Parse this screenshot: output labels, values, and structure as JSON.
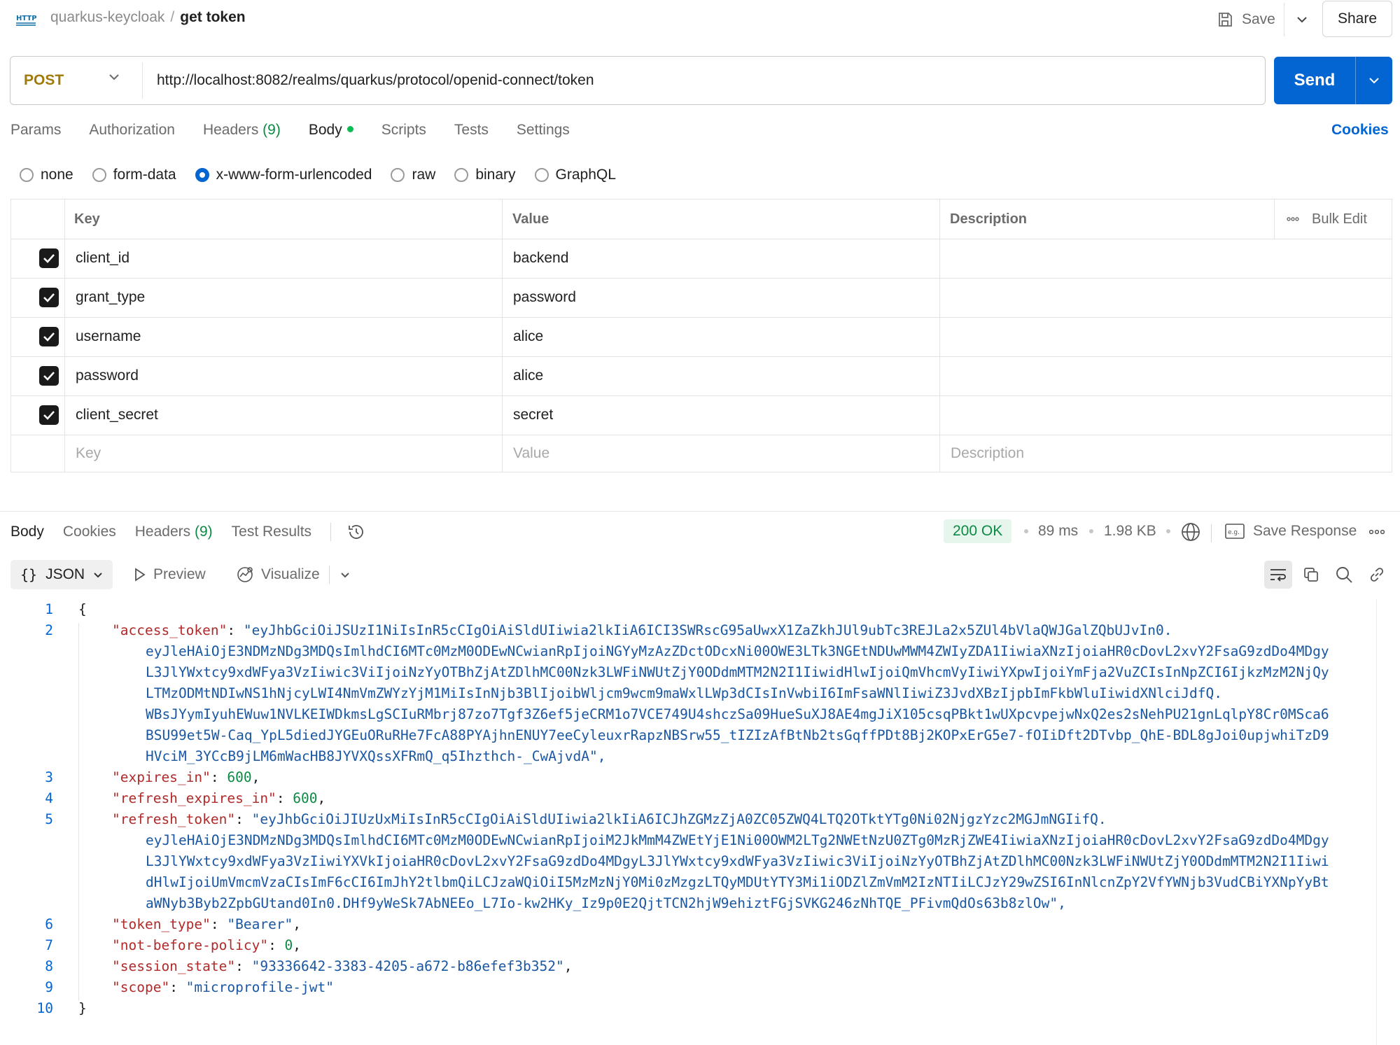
{
  "header": {
    "collection": "quarkus-keycloak",
    "separator": "/",
    "request_name": "get token",
    "save_label": "Save",
    "share_label": "Share"
  },
  "request": {
    "method": "POST",
    "url": "http://localhost:8082/realms/quarkus/protocol/openid-connect/token",
    "send_label": "Send"
  },
  "request_tabs": [
    {
      "label": "Params"
    },
    {
      "label": "Authorization"
    },
    {
      "label": "Headers",
      "count": "(9)"
    },
    {
      "label": "Body"
    },
    {
      "label": "Scripts"
    },
    {
      "label": "Tests"
    },
    {
      "label": "Settings"
    }
  ],
  "cookies_label": "Cookies",
  "body_types": [
    "none",
    "form-data",
    "x-www-form-urlencoded",
    "raw",
    "binary",
    "GraphQL"
  ],
  "body_type_selected": "x-www-form-urlencoded",
  "params_table": {
    "headers": {
      "key": "Key",
      "value": "Value",
      "description": "Description",
      "bulk_edit": "Bulk Edit"
    },
    "rows": [
      {
        "key": "client_id",
        "value": "backend",
        "checked": true
      },
      {
        "key": "grant_type",
        "value": "password",
        "checked": true
      },
      {
        "key": "username",
        "value": "alice",
        "checked": true
      },
      {
        "key": "password",
        "value": "alice",
        "checked": true
      },
      {
        "key": "client_secret",
        "value": "secret",
        "checked": true
      }
    ],
    "placeholders": {
      "key": "Key",
      "value": "Value",
      "description": "Description"
    }
  },
  "response": {
    "tabs": [
      {
        "label": "Body"
      },
      {
        "label": "Cookies"
      },
      {
        "label": "Headers",
        "count": "(9)"
      },
      {
        "label": "Test Results"
      }
    ],
    "status": "200 OK",
    "time": "89 ms",
    "size": "1.98 KB",
    "save_response_label": "Save Response",
    "format_label": "JSON",
    "preview_label": "Preview",
    "visualize_label": "Visualize",
    "body": {
      "open_brace": "{",
      "close_brace": "}",
      "access_token_key": "\"access_token\"",
      "access_token_lines": [
        "\"eyJhbGciOiJSUzI1NiIsInR5cCIgOiAiSldUIiwia2lkIiA6ICI3SWRscG95aUwxX1ZaZkhJUl9ubTc3REJLa2x5ZUl4bVlaQWJGalZQbUJvIn0.",
        "eyJleHAiOjE3NDMzNDg3MDQsImlhdCI6MTc0MzM0ODEwNCwianRpIjoiNGYyMzAzZDctODcxNi00OWE3LTk3NGEtNDUwMWM4ZWIyZDA1IiwiaXNzIjoiaHR0cDovL2xvY2FsaG9zdDo4MDgy",
        "L3JlYWxtcy9xdWFya3VzIiwic3ViIjoiNzYyOTBhZjAtZDlhMC00Nzk3LWFiNWUtZjY0ODdmMTM2N2I1IiwidHlwIjoiQmVhcmVyIiwiYXpwIjoiYmFja2VuZCIsInNpZCI6IjkzMzM2NjQy",
        "LTMzODMtNDIwNS1hNjcyLWI4NmVmZWYzYjM1MiIsInNjb3BlIjoibWljcm9wcm9maWxlLWp3dCIsInVwbiI6ImFsaWNlIiwiZ3JvdXBzIjpbImFkbWluIiwidXNlciJdfQ.",
        "WBsJYymIyuhEWuw1NVLKEIWDkmsLgSCIuRMbrj87zo7Tgf3Z6ef5jeCRM1o7VCE749U4shczSa09HueSuXJ8AE4mgJiX105csqPBkt1wUXpcvpejwNxQ2es2sNehPU21gnLqlpY8Cr0MSca6",
        "BSU99et5W-Caq_YpL5diedJYGEuORuRHe7FcA88PYAjhnENUY7eeCyleuxrRapzNBSrw55_tIZIzAfBtNb2tsGqffPDt8Bj2KOPxErG5e7-fOIiDft2DTvbp_QhE-BDL8gJoi0upjwhiTzD9",
        "HVciM_3YCcB9jLM6mWacHB8JYVXQssXFRmQ_q5Ihzthch-_CwAjvdA\","
      ],
      "expires_in_key": "\"expires_in\"",
      "expires_in": "600",
      "refresh_expires_in_key": "\"refresh_expires_in\"",
      "refresh_expires_in": "600",
      "refresh_token_key": "\"refresh_token\"",
      "refresh_token_lines": [
        "\"eyJhbGciOiJIUzUxMiIsInR5cCIgOiAiSldUIiwia2lkIiA6ICJhZGMzZjA0ZC05ZWQ4LTQ2OTktYTg0Ni02NjgzYzc2MGJmNGIifQ.",
        "eyJleHAiOjE3NDMzNDg3MDQsImlhdCI6MTc0MzM0ODEwNCwianRpIjoiM2JkMmM4ZWEtYjE1Ni00OWM2LTg2NWEtNzU0ZTg0MzRjZWE4IiwiaXNzIjoiaHR0cDovL2xvY2FsaG9zdDo4MDgy",
        "L3JlYWxtcy9xdWFya3VzIiwiYXVkIjoiaHR0cDovL2xvY2FsaG9zdDo4MDgyL3JlYWxtcy9xdWFya3VzIiwic3ViIjoiNzYyOTBhZjAtZDlhMC00Nzk3LWFiNWUtZjY0ODdmMTM2N2I1Iiwi",
        "dHlwIjoiUmVmcmVzaCIsImF6cCI6ImJhY2tlbmQiLCJzaWQiOiI5MzMzNjY0Mi0zMzgzLTQyMDUtYTY3Mi1iODZlZmVmM2IzNTIiLCJzY29wZSI6InNlcnZpY2VfYWNjb3VudCBiYXNpYyBt",
        "aWNyb3Byb2ZpbGUtand0In0.DHf9yWeSk7AbNEEo_L7Io-kw2HKy_Iz9p0E2QjtTCN2hjW9ehiztFGjSVKG246zNhTQE_PFivmQdOs63b8zlOw\","
      ],
      "token_type_key": "\"token_type\"",
      "token_type": "\"Bearer\"",
      "nbf_key": "\"not-before-policy\"",
      "nbf": "0",
      "session_state_key": "\"session_state\"",
      "session_state": "\"93336642-3383-4205-a672-b86efef3b352\"",
      "scope_key": "\"scope\"",
      "scope": "\"microprofile-jwt\""
    }
  },
  "colors": {
    "accent": "#0265d2",
    "method": "#a07a0a",
    "status_ok": "#0c8a43",
    "json_key": "#b02a2a",
    "json_string": "#1a57a3",
    "json_number": "#0c8a43"
  },
  "icons": [
    "http-icon",
    "save-icon",
    "chevron-down-icon",
    "history-icon",
    "globe-icon",
    "example-icon",
    "more-icon",
    "play-icon",
    "visualize-icon",
    "wrap-icon",
    "copy-icon",
    "search-icon",
    "link-icon",
    "checkbox-checked-icon"
  ]
}
